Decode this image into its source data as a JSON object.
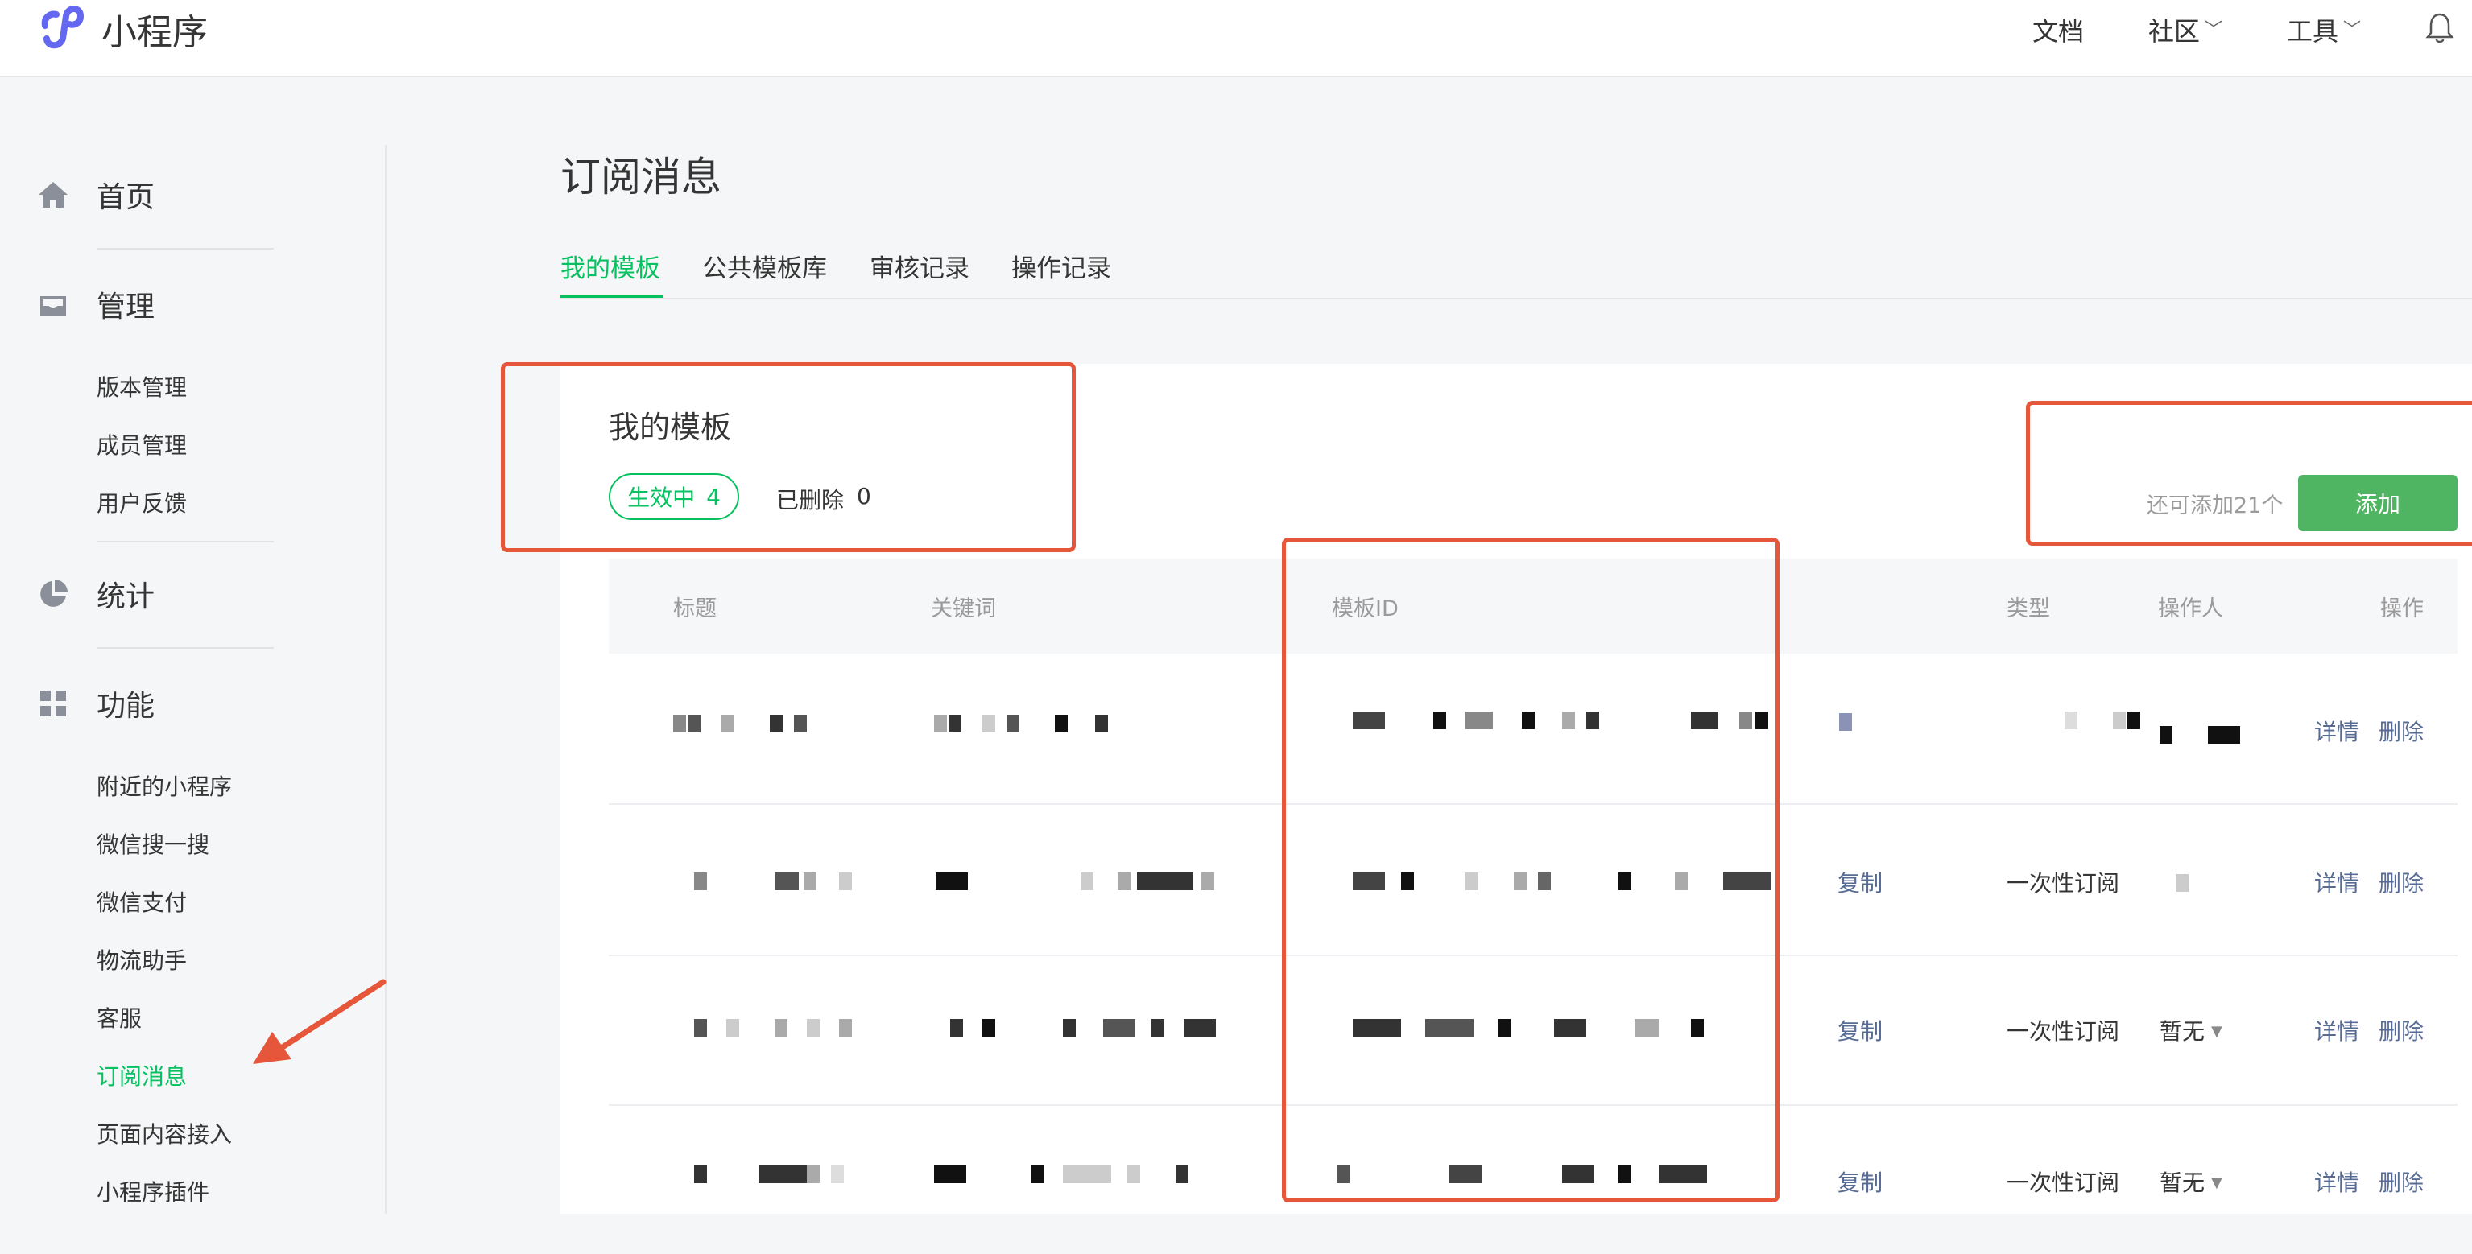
{
  "app": {
    "name": "小程序"
  },
  "top_nav": {
    "docs": "文档",
    "community": "社区",
    "tools": "工具"
  },
  "sidebar": {
    "home": "首页",
    "manage": "管理",
    "manage_items": [
      "版本管理",
      "成员管理",
      "用户反馈"
    ],
    "stats": "统计",
    "features": "功能",
    "feature_items": [
      "附近的小程序",
      "微信搜一搜",
      "微信支付",
      "物流助手",
      "客服",
      "订阅消息",
      "页面内容接入",
      "小程序插件"
    ],
    "active_item": "订阅消息"
  },
  "page": {
    "title": "订阅消息",
    "tabs": [
      "我的模板",
      "公共模板库",
      "审核记录",
      "操作记录"
    ],
    "active_tab": "我的模板"
  },
  "card": {
    "title": "我的模板",
    "active_label": "生效中",
    "active_count": "4",
    "deleted_label": "已删除",
    "deleted_count": "0",
    "remain_text": "还可添加21个",
    "add_button": "添加"
  },
  "table": {
    "headers": [
      "标题",
      "关键词",
      "模板ID",
      "类型",
      "操作人",
      "操作"
    ],
    "rows": [
      {
        "copy": "",
        "type": "",
        "operator": "",
        "detail": "详情",
        "delete": "删除"
      },
      {
        "copy": "复制",
        "type": "一次性订阅",
        "operator": "",
        "detail": "详情",
        "delete": "删除"
      },
      {
        "copy": "复制",
        "type": "一次性订阅",
        "operator": "暂无",
        "detail": "详情",
        "delete": "删除"
      },
      {
        "copy": "复制",
        "type": "一次性订阅",
        "operator": "暂无",
        "detail": "详情",
        "delete": "删除"
      }
    ]
  },
  "colors": {
    "accent": "#07c160",
    "link": "#576b95",
    "annotation": "#e5563a"
  }
}
